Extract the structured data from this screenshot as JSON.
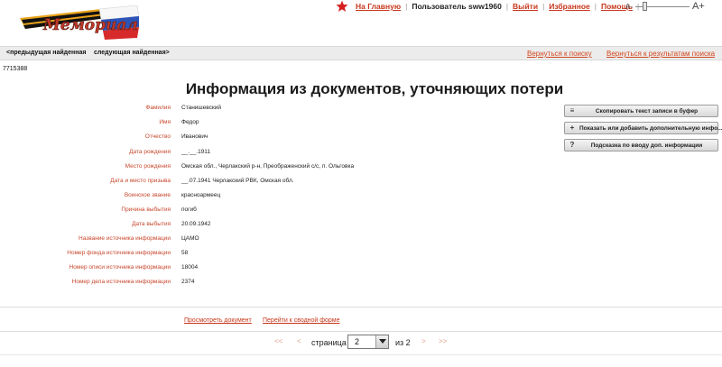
{
  "header": {
    "logo_text": "Мемориал",
    "nav": {
      "home": "На Главную",
      "user": "Пользователь sww1960",
      "logout": "Выйти",
      "favorites": "Избранное",
      "help": "Помощь"
    },
    "font_small": "A-",
    "font_big": "A+",
    "font_level": 0.15
  },
  "navbar": {
    "prev": "<предыдущая найденная",
    "next": "следующая найденная>",
    "back_search": "Вернуться к поиску",
    "back_results": "Вернуться к результатам поиска"
  },
  "record_id": "7715388",
  "title": "Информация из документов, уточняющих потери",
  "fields": [
    {
      "label": "Фамилия",
      "value": "Станишевский"
    },
    {
      "label": "Имя",
      "value": "Федор"
    },
    {
      "label": "Отчество",
      "value": "Иванович"
    },
    {
      "label": "Дата рождения",
      "value": "__.__.1911"
    },
    {
      "label": "Место рождения",
      "value": "Омская обл., Черлакский р-н, Преображенский с/с, п. Ольговка"
    },
    {
      "label": "Дата и место призыва",
      "value": "__.07.1941 Черлакский РВК, Омская обл."
    },
    {
      "label": "Воинское звание",
      "value": "красноармеец"
    },
    {
      "label": "Причина выбытия",
      "value": "погиб"
    },
    {
      "label": "Дата выбытия",
      "value": "20.09.1942"
    },
    {
      "label": "Название источника информации",
      "value": "ЦАМО"
    },
    {
      "label": "Номер фонда источника информации",
      "value": "58"
    },
    {
      "label": "Номер описи источника информации",
      "value": "18004"
    },
    {
      "label": "Номер дела источника информации",
      "value": "2374"
    }
  ],
  "buttons": {
    "copy": "Скопировать текст записи в буфер",
    "add_info": "Показать или добавить дополнительную инфо...",
    "hint": "Подсказка по вводу доп. информации"
  },
  "bottom_links": {
    "view_doc": "Просмотреть документ",
    "summary": "Перейти к сводной форме"
  },
  "pager": {
    "first": "<<",
    "prev": "<",
    "page_label": "страница",
    "current": "2",
    "of_label": "из 2",
    "next": ">",
    "last": ">>"
  },
  "colors": {
    "accent": "#c8361b",
    "label": "#c7472c"
  }
}
